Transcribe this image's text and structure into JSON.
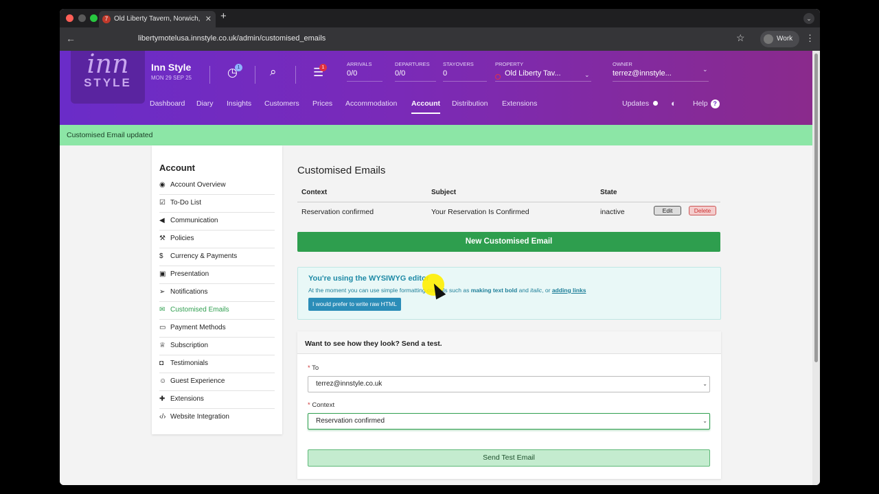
{
  "browser": {
    "tab_title": "Old Liberty Tavern, Norwich,",
    "tab_favicon": "7",
    "url": "libertymotelusa.innstyle.co.uk/admin/customised_emails",
    "profile": "Work"
  },
  "header": {
    "brand": "Inn Style",
    "date": "MON 29 SEP 25",
    "logo_top": "inn",
    "logo_bottom": "STYLE",
    "clock_badge": "1",
    "tasks_badge": "1",
    "arrivals_label": "ARRIVALS",
    "arrivals_value": "0/0",
    "departures_label": "DEPARTURES",
    "departures_value": "0/0",
    "stayovers_label": "STAYOVERS",
    "stayovers_value": "0",
    "property_label": "PROPERTY",
    "property_value": "Old Liberty Tav...",
    "owner_label": "OWNER",
    "owner_value": "terrez@innstyle..."
  },
  "nav": {
    "items": [
      "Dashboard",
      "Diary",
      "Insights",
      "Customers",
      "Prices",
      "Accommodation",
      "Account",
      "Distribution",
      "Extensions"
    ],
    "active": "Account",
    "updates": "Updates",
    "help": "Help"
  },
  "flash": "Customised Email updated",
  "sidebar": {
    "title": "Account",
    "items": [
      {
        "label": "Account Overview",
        "icon": "eye-icon"
      },
      {
        "label": "To-Do List",
        "icon": "checkbox-icon"
      },
      {
        "label": "Communication",
        "icon": "megaphone-icon"
      },
      {
        "label": "Policies",
        "icon": "gavel-icon"
      },
      {
        "label": "Currency & Payments",
        "icon": "dollar-icon"
      },
      {
        "label": "Presentation",
        "icon": "image-icon"
      },
      {
        "label": "Notifications",
        "icon": "paper-plane-icon"
      },
      {
        "label": "Customised Emails",
        "icon": "envelope-icon"
      },
      {
        "label": "Payment Methods",
        "icon": "card-icon"
      },
      {
        "label": "Subscription",
        "icon": "trophy-icon"
      },
      {
        "label": "Testimonials",
        "icon": "speech-bubble-icon"
      },
      {
        "label": "Guest Experience",
        "icon": "smiley-icon"
      },
      {
        "label": "Extensions",
        "icon": "puzzle-icon"
      },
      {
        "label": "Website Integration",
        "icon": "code-icon"
      }
    ],
    "active": "Customised Emails"
  },
  "main": {
    "title": "Customised Emails",
    "columns": [
      "Context",
      "Subject",
      "State"
    ],
    "rows": [
      {
        "context": "Reservation confirmed",
        "subject": "Your Reservation Is Confirmed",
        "state": "inactive",
        "edit": "Edit",
        "delete": "Delete"
      }
    ],
    "new_button": "New Customised Email",
    "info_title": "You're using the WYSIWYG editor",
    "info_text_1": "At the moment you can use simple formatting controls such as ",
    "info_bold": "making text bold",
    "info_text_2": " and ",
    "info_italic": "italic",
    "info_text_3": ", or ",
    "info_link": "adding links",
    "raw_html_button": "I would prefer to write raw HTML",
    "test_heading": "Want to see how they look? Send a test.",
    "to_label": "To",
    "to_value": "terrez@innstyle.co.uk",
    "context_label": "Context",
    "context_value": "Reservation confirmed",
    "send_button": "Send Test Email",
    "required_mark": "*"
  },
  "colors": {
    "header_gradient_start": "#6a2cc8",
    "header_gradient_end": "#8a2a8c",
    "flash_bg": "#8ce6a6",
    "primary_green": "#2e9e4e",
    "info_blue": "#1e8aa6"
  }
}
